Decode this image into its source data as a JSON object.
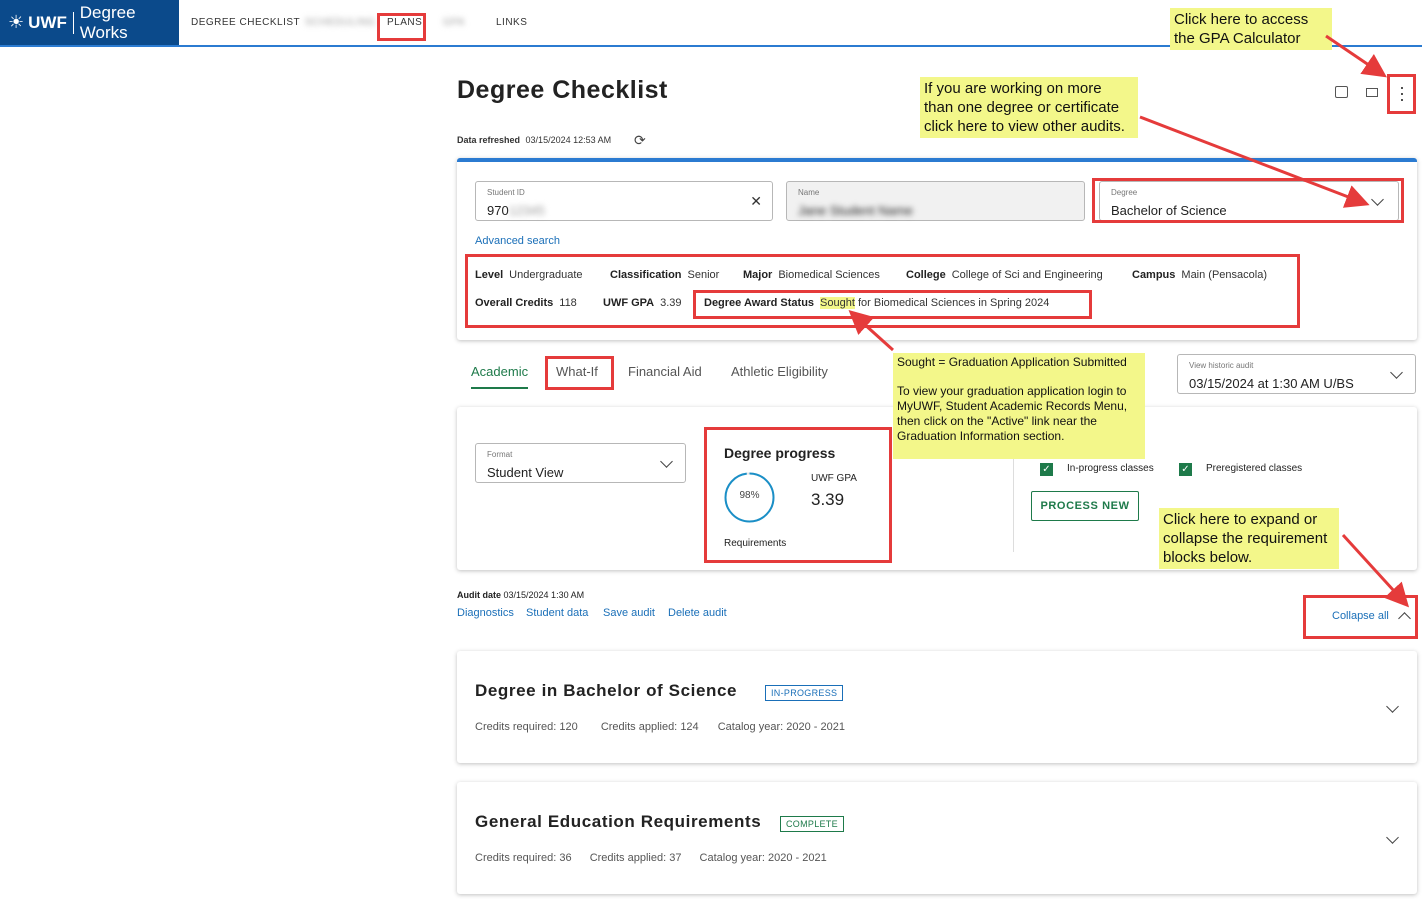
{
  "nav": {
    "logo_mark": "UWF",
    "logo_text": "Degree Works",
    "items": [
      "DEGREE CHECKLIST",
      "SCHEDULING",
      "PLANS",
      "GPA",
      "LINKS"
    ]
  },
  "header": {
    "title": "Degree Checklist",
    "refreshed_label": "Data refreshed",
    "refreshed_value": "03/15/2024 12:53 AM"
  },
  "student": {
    "id_label": "Student ID",
    "id_value": "970",
    "id_hidden": "12345",
    "name_label": "Name",
    "name_value": "Jane Student Name",
    "degree_label": "Degree",
    "degree_value": "Bachelor of Science",
    "advanced_search": "Advanced search",
    "level_label": "Level",
    "level": "Undergraduate",
    "class_label": "Classification",
    "classification": "Senior",
    "major_label": "Major",
    "major": "Biomedical Sciences",
    "college_label": "College",
    "college": "College of Sci and Engineering",
    "campus_label": "Campus",
    "campus": "Main (Pensacola)",
    "credits_label": "Overall Credits",
    "credits": "118",
    "gpa_label": "UWF GPA",
    "gpa": "3.39",
    "award_label": "Degree Award Status",
    "award_sought": "Sought",
    "award_rest": "for Biomedical Sciences in Spring 2024"
  },
  "tabs": [
    "Academic",
    "What-If",
    "Financial Aid",
    "Athletic Eligibility"
  ],
  "historic": {
    "label": "View historic audit",
    "value": "03/15/2024 at 1:30 AM U/BS"
  },
  "format": {
    "label": "Format",
    "value": "Student View"
  },
  "progress": {
    "title": "Degree progress",
    "percent": "98%",
    "percent_value": 0.98,
    "gpa_label": "UWF GPA",
    "gpa": "3.39",
    "req_label": "Requirements"
  },
  "options": {
    "inprogress": "In-progress classes",
    "prereg": "Preregistered classes",
    "process_button": "PROCESS NEW"
  },
  "audit": {
    "date_label": "Audit date",
    "date_value": "03/15/2024 1:30 AM",
    "links": [
      "Diagnostics",
      "Student data",
      "Save audit",
      "Delete audit"
    ],
    "collapse": "Collapse all"
  },
  "blocks": [
    {
      "title": "Degree in Bachelor of Science",
      "status": "IN-PROGRESS",
      "credits_req_label": "Credits required:",
      "credits_req": "120",
      "credits_app_label": "Credits applied:",
      "credits_app": "124",
      "catalog_label": "Catalog year:",
      "catalog": "2020 - 2021"
    },
    {
      "title": "General Education Requirements",
      "status": "COMPLETE",
      "credits_req_label": "Credits required:",
      "credits_req": "36",
      "credits_app_label": "Credits applied:",
      "credits_app": "37",
      "catalog_label": "Catalog year:",
      "catalog": "2020 - 2021"
    }
  ],
  "callouts": {
    "gpa_calc": "Click here to access the GPA Calculator",
    "other_audits": "If you are working on more than one degree or certificate click here to view other audits.",
    "sought_title": "Sought = Graduation Application Submitted",
    "sought_body": "To view your graduation application login to MyUWF, Student Academic Records Menu, then click on the \"Active\" link near the Graduation Information section.",
    "collapse": "Click here to expand or collapse the requirement blocks below."
  },
  "colors": {
    "brand": "#0b4a8b",
    "accent": "#2b7bd1",
    "green": "#1e7a4a",
    "highlight": "#f3f78a",
    "annotation_red": "#e53b3b"
  }
}
